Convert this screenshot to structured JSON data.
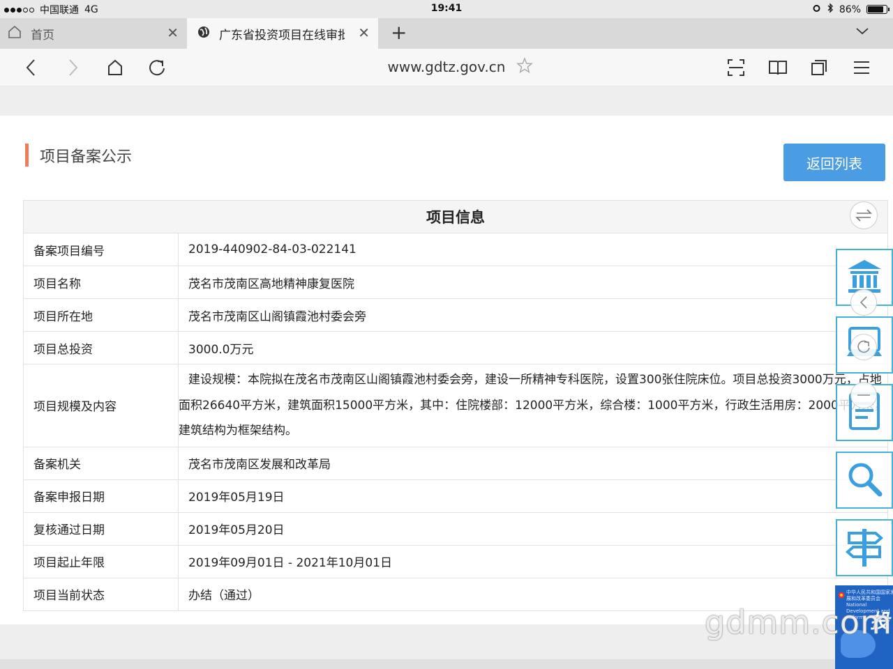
{
  "status_bar": {
    "carrier": "中国联通",
    "network": "4G",
    "time": "19:41",
    "battery": "86%",
    "battery_level": 0.86
  },
  "tabs": [
    {
      "title": "首页",
      "icon": "home-icon"
    },
    {
      "title": "广东省投资项目在线审批",
      "icon": "globe-icon"
    }
  ],
  "address_bar": {
    "url": "www.gdtz.gov.cn"
  },
  "page": {
    "section_title": "项目备案公示",
    "back_button": "返回列表",
    "table_title": "项目信息",
    "rows": [
      {
        "label": "备案项目编号",
        "value": "2019-440902-84-03-022141"
      },
      {
        "label": "项目名称",
        "value": "茂名市茂南区高地精神康复医院"
      },
      {
        "label": "项目所在地",
        "value": "茂名市茂南区山阁镇霞池村委会旁"
      },
      {
        "label": "项目总投资",
        "value": "3000.0万元"
      },
      {
        "label": "项目规模及内容",
        "value": "建设规模：本院拟在茂名市茂南区山阁镇霞池村委会旁，建设一所精神专科医院，设置300张住院床位。项目总投资3000万元，占地面积26640平方米，建筑面积15000平方米，其中：住院楼部：12000平方米，综合楼：1000平方米，行政生活用房：2000平方米，建筑结构为框架结构。"
      },
      {
        "label": "备案机关",
        "value": "茂名市茂南区发展和改革局"
      },
      {
        "label": "备案申报日期",
        "value": "2019年05月19日"
      },
      {
        "label": "复核通过日期",
        "value": "2019年05月20日"
      },
      {
        "label": "项目起止年限",
        "value": "2019年09月01日 - 2021年10月01日"
      },
      {
        "label": "项目当前状态",
        "value": "办结（通过）"
      }
    ]
  },
  "promo": {
    "small_text": "中华人民共和国国家发展和改革委员会 National Development and Reform",
    "big_text": "投"
  },
  "watermark": "gdmm.com",
  "colors": {
    "accent": "#ef7b57",
    "button": "#4a9de3",
    "toolbar_border": "#42b3d8",
    "promo": "#1f64c3"
  }
}
